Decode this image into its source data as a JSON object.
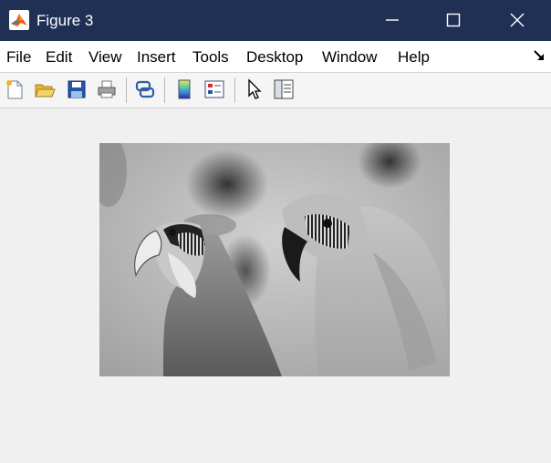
{
  "window": {
    "title": "Figure 3"
  },
  "menu": {
    "items": [
      {
        "label": "File"
      },
      {
        "label": "Edit"
      },
      {
        "label": "View"
      },
      {
        "label": "Insert"
      },
      {
        "label": "Tools"
      },
      {
        "label": "Desktop"
      },
      {
        "label": "Window"
      },
      {
        "label": "Help"
      }
    ]
  },
  "toolbar": {
    "icons": [
      "new-figure-icon",
      "open-file-icon",
      "save-icon",
      "print-icon",
      "link-plot-icon",
      "colorbar-icon",
      "legend-icon",
      "pointer-icon",
      "property-editor-icon"
    ]
  },
  "colors": {
    "titlebar": "#1f3054",
    "background": "#f0f0f0",
    "menubar": "#ffffff"
  },
  "image": {
    "content": "grayscale-inverted-parrots"
  }
}
